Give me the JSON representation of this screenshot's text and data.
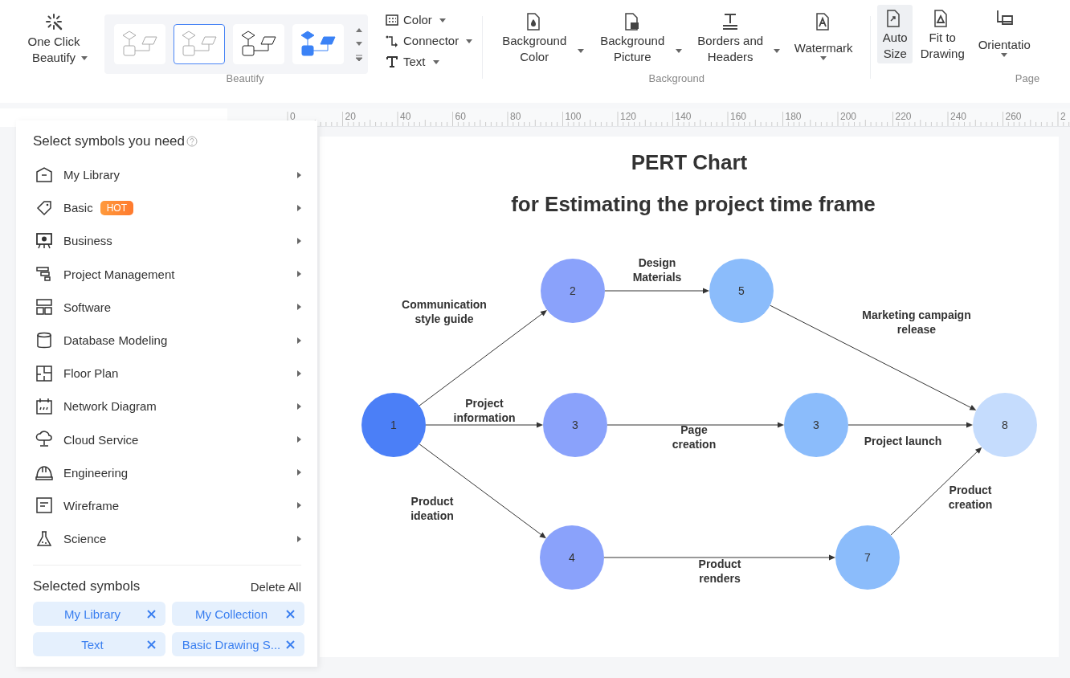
{
  "ribbon": {
    "beautify": {
      "one_click": "One Click Beautify",
      "styles": [
        {
          "kind": "outline-light",
          "selected": false
        },
        {
          "kind": "outline-light",
          "selected": true
        },
        {
          "kind": "outline-dark",
          "selected": false
        },
        {
          "kind": "filled-blue",
          "selected": false
        }
      ],
      "menus": [
        "Color",
        "Connector",
        "Text"
      ],
      "label": "Beautify"
    },
    "background": {
      "buttons": [
        "Background Color",
        "Background Picture",
        "Borders and Headers",
        "Watermark"
      ],
      "label": "Background"
    },
    "page": {
      "buttons": [
        {
          "label": "Auto Size",
          "selected": true
        },
        {
          "label": "Fit to Drawing",
          "selected": false
        },
        {
          "label": "Orientatio",
          "selected": false
        }
      ],
      "label": "Page"
    }
  },
  "ruler": {
    "labels": [
      "0",
      "20",
      "40",
      "60",
      "80",
      "100",
      "120",
      "140",
      "160",
      "180",
      "200",
      "220",
      "240",
      "260",
      "2"
    ]
  },
  "symbols_panel": {
    "title": "Select symbols you need",
    "categories": [
      {
        "label": "My Library"
      },
      {
        "label": "Basic",
        "badge": "HOT"
      },
      {
        "label": "Business"
      },
      {
        "label": "Project Management"
      },
      {
        "label": "Software"
      },
      {
        "label": "Database Modeling"
      },
      {
        "label": "Floor Plan"
      },
      {
        "label": "Network Diagram"
      },
      {
        "label": "Cloud Service"
      },
      {
        "label": "Engineering"
      },
      {
        "label": "Wireframe"
      },
      {
        "label": "Science"
      }
    ],
    "selected_title": "Selected symbols",
    "delete_all": "Delete All",
    "chips": [
      "My Library",
      "My Collection",
      "Text",
      "Basic Drawing S..."
    ]
  },
  "diagram": {
    "title": "PERT Chart",
    "subtitle": "for Estimating the project time frame",
    "nodes": [
      {
        "label": "1",
        "color": "#4b7ff7"
      },
      {
        "label": "2",
        "color": "#8aa2fb"
      },
      {
        "label": "5",
        "color": "#8bbcfb"
      },
      {
        "label": "3",
        "color": "#8aa2fb"
      },
      {
        "label": "3",
        "color": "#8bbcfb"
      },
      {
        "label": "8",
        "color": "#c5dcfd"
      },
      {
        "label": "4",
        "color": "#8aa2fb"
      },
      {
        "label": "7",
        "color": "#8bbcfb"
      }
    ],
    "edges": [
      {
        "label": "Communication\nstyle guide"
      },
      {
        "label": "Design\nMaterials"
      },
      {
        "label": "Marketing campaign\nrelease"
      },
      {
        "label": "Project\ninformation"
      },
      {
        "label": "Page\ncreation"
      },
      {
        "label": "Project launch"
      },
      {
        "label": "Product\nideation"
      },
      {
        "label": "Product\nrenders"
      },
      {
        "label": "Product\ncreation"
      }
    ]
  }
}
